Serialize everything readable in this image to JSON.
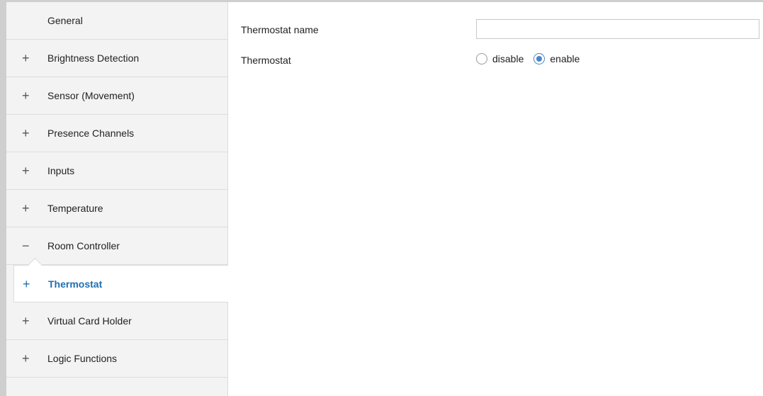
{
  "sidebar": {
    "items": [
      {
        "sign": "",
        "label": "General"
      },
      {
        "sign": "+",
        "label": "Brightness Detection"
      },
      {
        "sign": "+",
        "label": "Sensor (Movement)"
      },
      {
        "sign": "+",
        "label": "Presence Channels"
      },
      {
        "sign": "+",
        "label": "Inputs"
      },
      {
        "sign": "+",
        "label": "Temperature"
      },
      {
        "sign": "−",
        "label": "Room Controller"
      },
      {
        "sign": "+",
        "label": "Thermostat",
        "selected": true
      },
      {
        "sign": "+",
        "label": "Virtual Card Holder"
      },
      {
        "sign": "+",
        "label": "Logic Functions"
      }
    ]
  },
  "main": {
    "thermostat_name": {
      "label": "Thermostat name",
      "value": "",
      "placeholder": ""
    },
    "thermostat": {
      "label": "Thermostat",
      "options": [
        {
          "label": "disable",
          "checked": false
        },
        {
          "label": "enable",
          "checked": true
        }
      ]
    }
  },
  "colors": {
    "accent": "#1e6fb0",
    "radio_selected": "#4a86c5",
    "sidebar_bg": "#f3f3f3"
  }
}
